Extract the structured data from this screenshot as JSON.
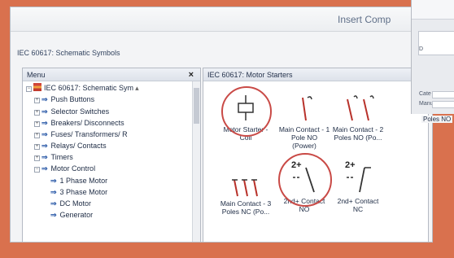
{
  "window": {
    "title": "Insert Comp"
  },
  "header": {
    "library_title": "IEC 60617: Schematic Symbols"
  },
  "menu": {
    "title": "Menu",
    "close": "×",
    "items": [
      {
        "label": "IEC 60617: Schematic Sym"
      },
      {
        "label": "Push Buttons"
      },
      {
        "label": "Selector Switches"
      },
      {
        "label": "Breakers/ Disconnects"
      },
      {
        "label": "Fuses/ Transformers/ R"
      },
      {
        "label": "Relays/ Contacts"
      },
      {
        "label": "Timers"
      },
      {
        "label": "Motor Control"
      },
      {
        "label": "1 Phase Motor"
      },
      {
        "label": "3 Phase Motor"
      },
      {
        "label": "DC Motor"
      },
      {
        "label": "Generator"
      }
    ]
  },
  "symbols_panel": {
    "title": "IEC 60617: Motor Starters",
    "symbols": [
      {
        "label1": "Motor Starter -",
        "label2": "Coil",
        "icon": "coil-icon"
      },
      {
        "label1": "Main Contact - 1",
        "label2": "Pole NO (Power)",
        "icon": "contact-no-1pole-icon"
      },
      {
        "label1": "Main Contact - 2",
        "label2": "Poles NO (Po...",
        "icon": "contact-no-2pole-icon"
      },
      {
        "label1": "Main Contact - 3",
        "label2": "Poles NC (Po...",
        "icon": "contact-nc-3pole-icon"
      },
      {
        "label1": "2nd+ Contact",
        "label2": "NO",
        "icon": "aux-contact-no-icon",
        "prefix": "2+"
      },
      {
        "label1": "2nd+ Contact",
        "label2": "NC",
        "icon": "aux-contact-nc-icon",
        "prefix": "2+"
      }
    ]
  },
  "second_dialog": {
    "line1": "D",
    "line2": "Ce",
    "field_label": "Cate",
    "field2_label": "Manu",
    "label_bottom": "Poles NO"
  },
  "colors": {
    "background": "#d9714e",
    "highlight_circle": "#c94a46",
    "symbol_red": "#b8322b"
  }
}
